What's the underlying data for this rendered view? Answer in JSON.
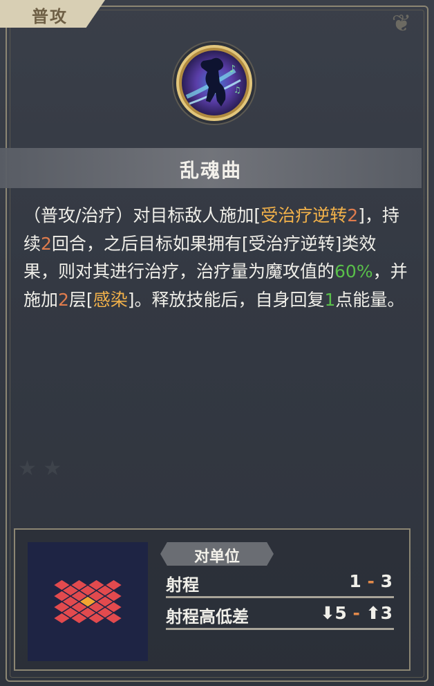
{
  "tab": {
    "label": "普攻"
  },
  "skill": {
    "name": "乱魂曲",
    "icon": "dancer-music-icon",
    "description": {
      "part1": "（普攻/治疗）对目标敌人施加[",
      "kw1": "受治疗逆转",
      "num1": "2",
      "part2": "]，持续",
      "num2": "2",
      "part3": "回合，之后目标如果拥有[受治疗逆转]类效果，则对其进行治疗，治疗量为魔攻值的",
      "pct": "60%",
      "part4": "，并施加",
      "num3": "2",
      "part5": "层[",
      "kw2": "感染",
      "part6": "]。释放技能后，自身回复",
      "num4": "1",
      "part7": "点能量。"
    }
  },
  "target": {
    "label": "对单位",
    "range_label": "射程",
    "range_min": "1",
    "range_sep": "-",
    "range_max": "3",
    "height_label": "射程高低差",
    "height_down": "⬇5",
    "height_sep": "-",
    "height_up": "⬆3"
  },
  "colors": {
    "keyword": "#f3b24a",
    "number": "#e07c4d",
    "percent": "#59c04a",
    "tile": "#e24a4e",
    "center_tile": "#f2a531"
  }
}
